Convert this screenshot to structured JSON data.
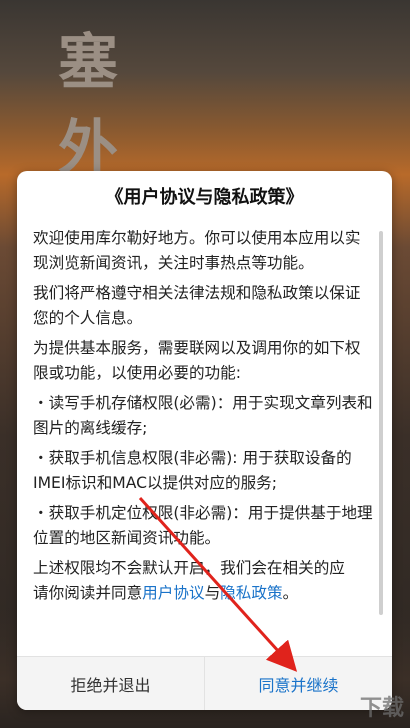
{
  "background": {
    "title_chars": [
      "塞",
      "外"
    ]
  },
  "dialog": {
    "title": "《用户协议与隐私政策》",
    "paragraphs": [
      "欢迎使用库尔勒好地方。你可以使用本应用以实现浏览新闻资讯，关注时事热点等功能。",
      "我们将严格遵守相关法律法规和隐私政策以保证您的个人信息。",
      "为提供基本服务，需要联网以及调用你的如下权限或功能，以使用必要的功能:",
      "・读写手机存储权限(必需)：用于实现文章列表和图片的离线缓存;",
      "・获取手机信息权限(非必需): 用于获取设备的IMEI标识和MAC以提供对应的服务;",
      "・获取手机定位权限(非必需)：用于提供基于地理位置的地区新闻资讯功能。"
    ],
    "last_line_prefix": "上述权限均不会默认开启，我们会在相关的应",
    "last_line_start": "请你阅读并同意",
    "link_agreement": "用户协议",
    "link_and": "与",
    "link_privacy": "隐私政策",
    "last_line_end": "。",
    "reject_label": "拒绝并退出",
    "agree_label": "同意并继续"
  },
  "watermark": "下载",
  "colors": {
    "accent": "#1a73c9",
    "arrow": "#e0231c"
  }
}
